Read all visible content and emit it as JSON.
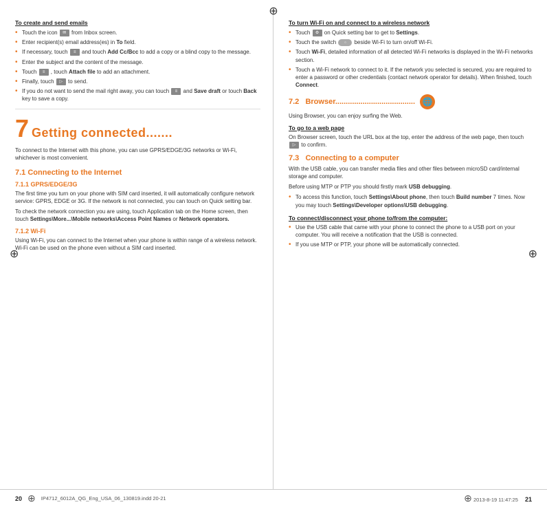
{
  "compass_symbol": "⊕",
  "left_page": {
    "page_number": "20",
    "email_section": {
      "heading": "To create and send emails",
      "bullets": [
        "Touch the icon  from Inbox screen.",
        "Enter recipient(s) email address(es) in To field.",
        "If necessary, touch  and touch Add Cc/Bcc to add a copy or a blind copy to the message.",
        "Enter the subject and the content of the message.",
        "Touch  , touch Attach file to add an attachment.",
        "Finally, touch  to send.",
        "If you do not want to send the mail right away, you can touch  and Save draft or touch Back key to save a copy."
      ]
    },
    "chapter": {
      "number": "7",
      "title": "Getting connected.......",
      "description": "To connect to the Internet with this phone, you can use GPRS/EDGE/3G networks or Wi-Fi, whichever is most convenient."
    },
    "section_7_1": {
      "title": "7.1    Connecting to the Internet",
      "subsection_7_1_1": {
        "title": "7.1.1   GPRS/EDGE/3G",
        "text1": "The first time you turn on your phone with SIM card inserted, it will automatically configure network service: GPRS, EDGE or 3G. If the network is not connected, you can touch  on Quick setting bar.",
        "text2": "To check the network connection you are using, touch Application tab on the Home screen, then touch Settings\\More...\\Mobile networks\\Access Point Names or Network operators."
      },
      "subsection_7_1_2": {
        "title": "7.1.2   Wi-Fi",
        "text": "Using Wi-Fi, you can connect to the Internet when your phone is within range of a wireless network. Wi-Fi can be used on the phone even without a SIM card inserted."
      }
    }
  },
  "right_page": {
    "page_number": "21",
    "wifi_section": {
      "heading": "To turn Wi-Fi on and connect to a wireless network",
      "bullets": [
        "Touch  on Quick setting bar to get to Settings.",
        "Touch the switch  beside Wi-Fi to  turn on/off Wi-Fi.",
        "Touch Wi-Fi, detailed information of all detected Wi-Fi networks is displayed in the Wi-Fi networks section.",
        "Touch a Wi-Fi network to connect to it. If the network you selected is secured, you are required to enter a password or other credentials (contact network operator for details). When finished, touch Connect."
      ]
    },
    "section_7_2": {
      "number": "7.2",
      "title": "Browser......................................",
      "icon": "🌐",
      "text1": "Using Browser, you can enjoy surfing the Web.",
      "subheading": "To go to a web page",
      "text2": "On Browser screen, touch the URL box at the top, enter the address of the web page, then touch  to confirm."
    },
    "section_7_3": {
      "number": "7.3",
      "title": "Connecting to a computer",
      "text1": "With the USB cable, you can transfer media files and other files between microSD card/internal storage and computer.",
      "text2": "Before using MTP or PTP you should firstly mark USB debugging.",
      "bullets": [
        "To access this function, touch Settings\\About phone, then touch Build number 7 times. Now you may touch Settings\\Developer options\\USB debugging.",
        "Use the USB cable that came with your phone to connect the phone to a USB port on your computer. You will receive a notification that the USB is connected.",
        "If you use MTP or PTP, your phone will be automatically connected."
      ],
      "connect_heading": "To connect/disconnect your phone to/from the computer:"
    }
  },
  "footer": {
    "left_file": "IP4712_6012A_QG_Eng_USA_06_130819.indd  20-21",
    "right_info": "2013-8-19   11:47:25"
  }
}
